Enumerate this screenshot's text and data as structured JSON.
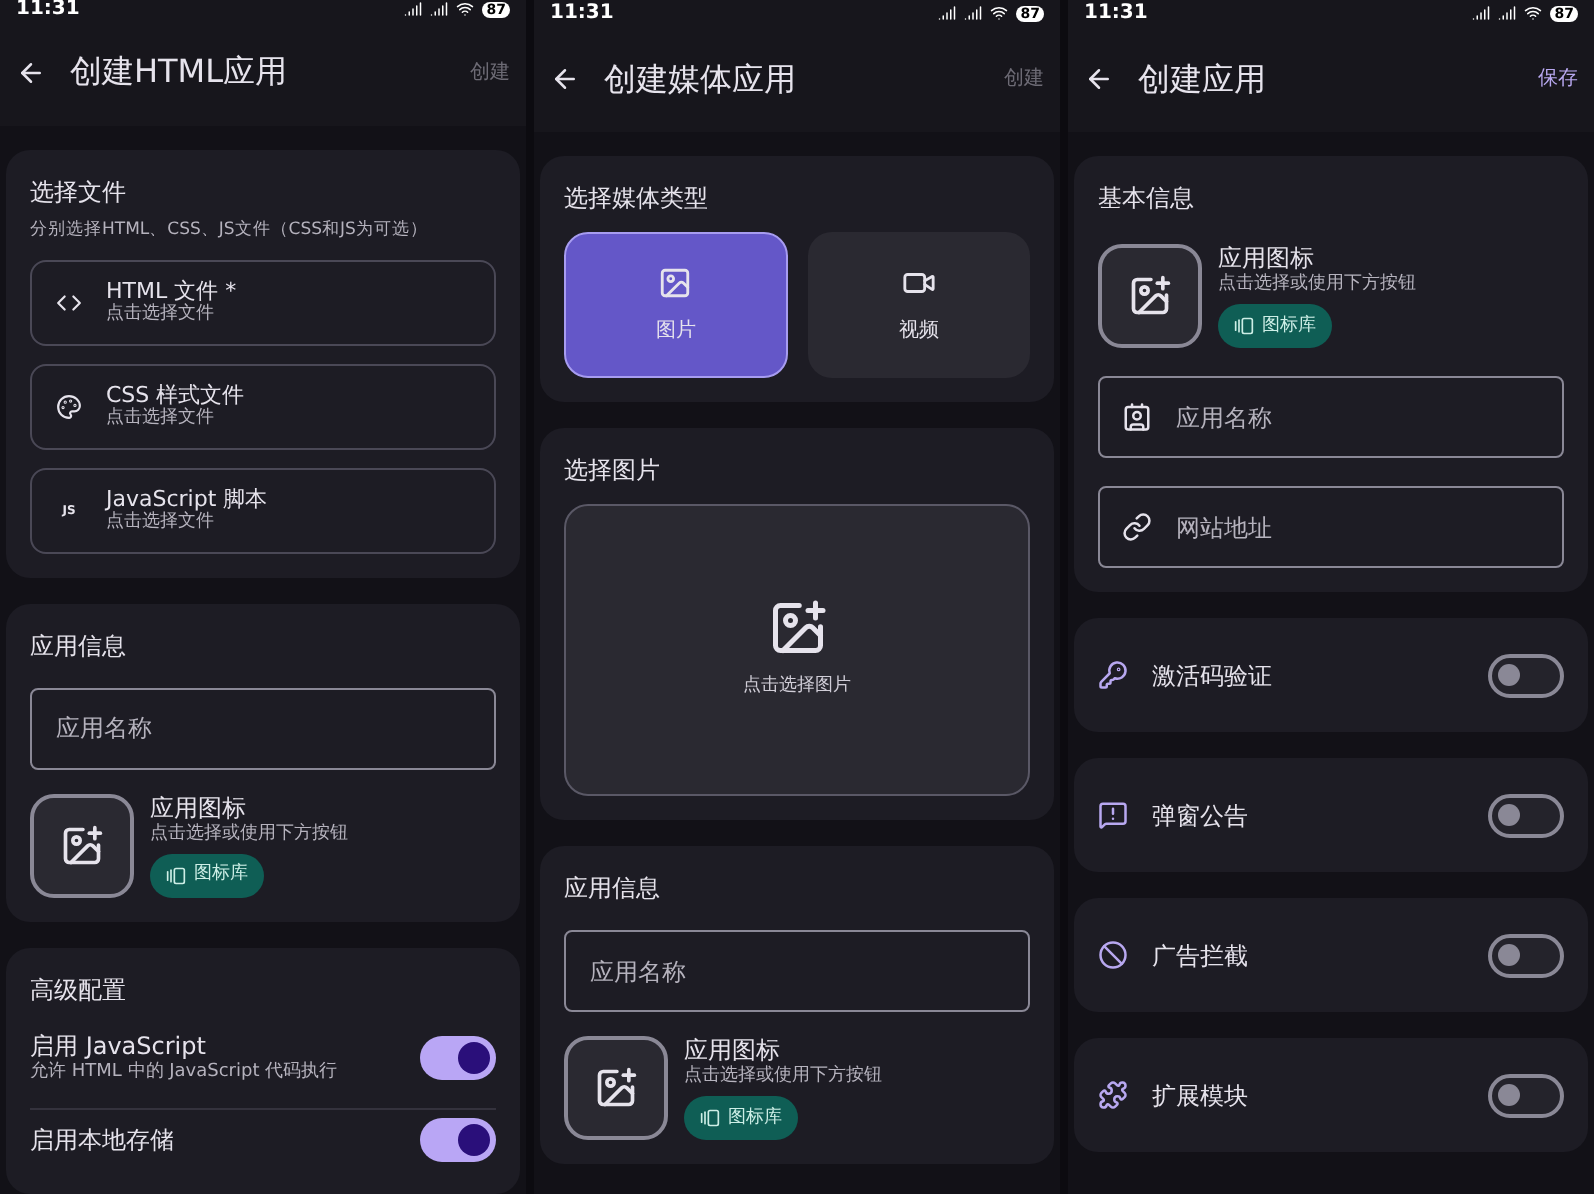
{
  "screens": [
    {
      "status": {
        "time": "11:31",
        "battery": "87"
      },
      "title": "创建HTML应用",
      "action": {
        "label": "创建",
        "disabled": true
      },
      "sections": [
        {
          "kind": "files",
          "title": "选择文件",
          "subtitle": "分别选择HTML、CSS、JS文件（CSS和JS为可选）",
          "items": [
            {
              "kind": "code",
              "label": "HTML 文件 *",
              "hint": "点击选择文件"
            },
            {
              "kind": "palette",
              "label": "CSS 样式文件",
              "hint": "点击选择文件"
            },
            {
              "kind": "js",
              "icon_text": "JS",
              "label": "JavaScript 脚本",
              "hint": "点击选择文件"
            }
          ]
        },
        {
          "kind": "app_info",
          "title": "应用信息",
          "name_placeholder": "应用名称",
          "icon_label": "应用图标",
          "icon_hint": "点击选择或使用下方按钮",
          "library_button": "图标库"
        },
        {
          "kind": "advanced",
          "title": "高级配置",
          "items": [
            {
              "label": "启用 JavaScript",
              "hint": "允许 HTML 中的 JavaScript 代码执行",
              "on": true
            },
            {
              "label": "启用本地存储",
              "on": true
            }
          ]
        }
      ]
    },
    {
      "status": {
        "time": "11:31",
        "battery": "87"
      },
      "title": "创建媒体应用",
      "action": {
        "label": "创建",
        "disabled": true
      },
      "sections": [
        {
          "kind": "media_type",
          "title": "选择媒体类型",
          "options": [
            {
              "kind": "image",
              "label": "图片",
              "selected": true
            },
            {
              "kind": "video",
              "label": "视频",
              "selected": false
            }
          ]
        },
        {
          "kind": "image_pick",
          "title": "选择图片",
          "hint": "点击选择图片"
        },
        {
          "kind": "app_info",
          "title": "应用信息",
          "name_placeholder": "应用名称",
          "icon_label": "应用图标",
          "icon_hint": "点击选择或使用下方按钮",
          "library_button": "图标库"
        }
      ]
    },
    {
      "status": {
        "time": "11:31",
        "battery": "87"
      },
      "title": "创建应用",
      "action": {
        "label": "保存",
        "disabled": false
      },
      "sections": [
        {
          "kind": "basic_info",
          "title": "基本信息",
          "icon_label": "应用图标",
          "icon_hint": "点击选择或使用下方按钮",
          "library_button": "图标库",
          "fields": [
            {
              "kind": "name",
              "placeholder": "应用名称"
            },
            {
              "kind": "link",
              "placeholder": "网站地址"
            }
          ]
        },
        {
          "kind": "features",
          "items": [
            {
              "kind": "key",
              "label": "激活码验证",
              "on": false
            },
            {
              "kind": "notice",
              "label": "弹窗公告",
              "on": false
            },
            {
              "kind": "block",
              "label": "广告拦截",
              "on": false
            },
            {
              "kind": "puzzle",
              "label": "扩展模块",
              "on": false
            }
          ]
        }
      ]
    }
  ]
}
